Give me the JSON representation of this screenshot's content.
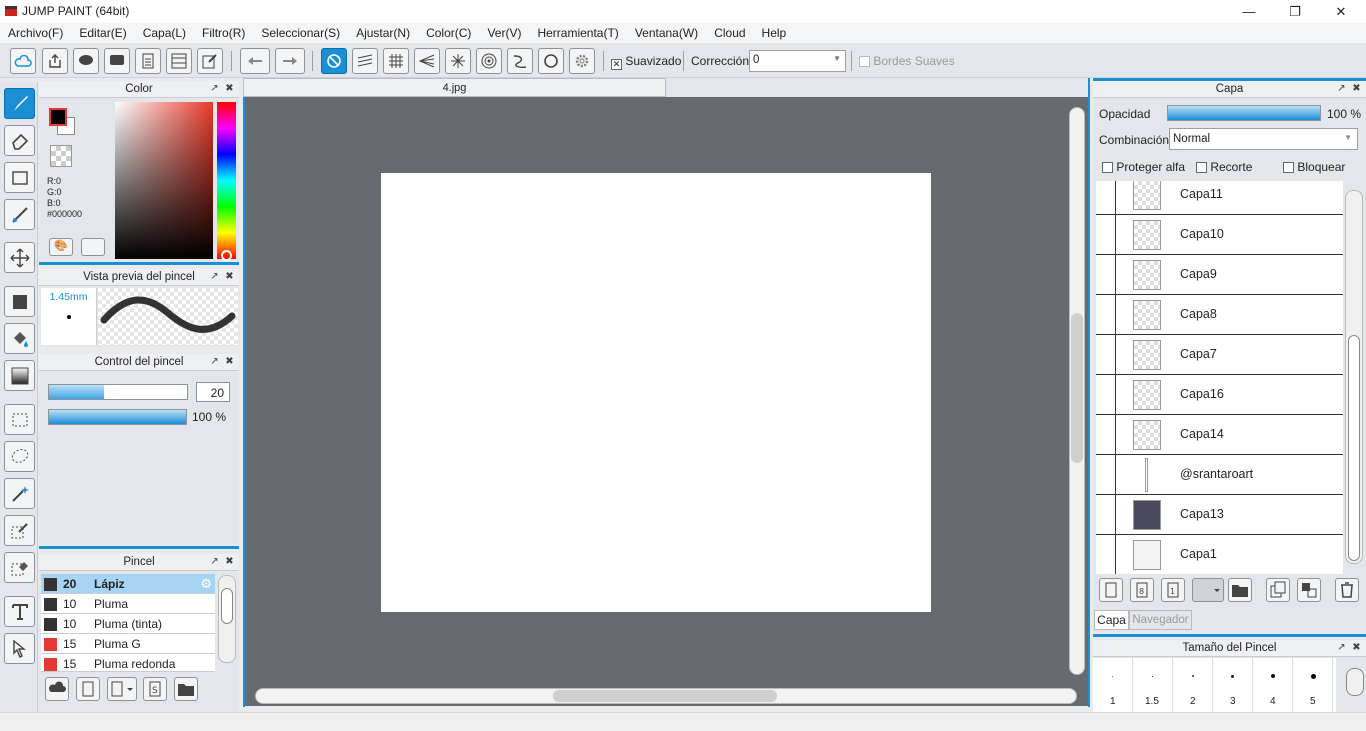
{
  "window": {
    "title": "JUMP PAINT (64bit)"
  },
  "menu": [
    "Archivo(F)",
    "Editar(E)",
    "Capa(L)",
    "Filtro(R)",
    "Seleccionar(S)",
    "Ajustar(N)",
    "Color(C)",
    "Ver(V)",
    "Herramienta(T)",
    "Ventana(W)",
    "Cloud",
    "Help"
  ],
  "toolbar": {
    "suavizado_label": "Suavizado",
    "correccion_label": "Corrección",
    "correccion_value": "0",
    "bordes_label": "Bordes Suaves"
  },
  "color_panel": {
    "title": "Color",
    "r": "R:0",
    "g": "G:0",
    "b": "B:0",
    "hex": "#000000"
  },
  "brush_preview": {
    "title": "Vista previa del pincel",
    "size": "1.45mm"
  },
  "brush_control": {
    "title": "Control del pincel",
    "size_value": "20",
    "opacity_value": "100 %",
    "size_fraction": 0.4,
    "opacity_fraction": 1.0
  },
  "brush_list": {
    "title": "Pincel",
    "items": [
      {
        "size": "20",
        "name": "Lápiz",
        "color": "#333333",
        "selected": true
      },
      {
        "size": "10",
        "name": "Pluma",
        "color": "#333333"
      },
      {
        "size": "10",
        "name": "Pluma (tinta)",
        "color": "#333333"
      },
      {
        "size": "15",
        "name": "Pluma G",
        "color": "#e53935"
      },
      {
        "size": "15",
        "name": "Pluma redonda",
        "color": "#e53935"
      }
    ]
  },
  "document": {
    "tab": "4.jpg"
  },
  "layer_panel": {
    "title": "Capa",
    "opacity_label": "Opacidad",
    "opacity_value": "100 %",
    "blend_label": "Combinación",
    "blend_value": "Normal",
    "protect_alpha": "Proteger alfa",
    "clip": "Recorte",
    "lock": "Bloquear",
    "layers": [
      "Capa11",
      "Capa10",
      "Capa9",
      "Capa8",
      "Capa7",
      "Capa16",
      "Capa14",
      "@srantaroart",
      "Capa13",
      "Capa1"
    ],
    "tabs": [
      "Capa",
      "Navegador"
    ]
  },
  "brush_size_panel": {
    "title": "Tamaño del Pincel",
    "sizes": [
      "1",
      "1.5",
      "2",
      "3",
      "4",
      "5"
    ]
  }
}
